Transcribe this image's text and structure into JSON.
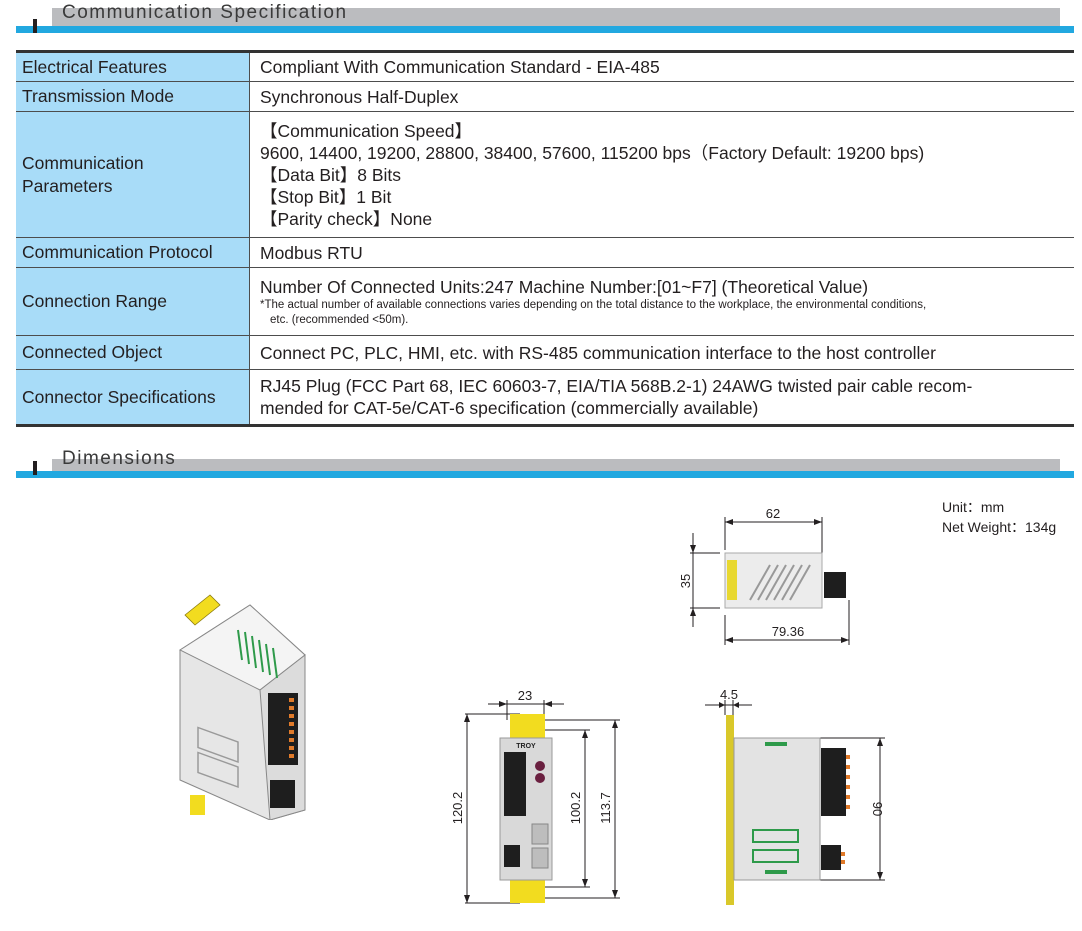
{
  "sections": {
    "communication": {
      "title": "Communication Specification"
    },
    "dimensions": {
      "title": "Dimensions"
    }
  },
  "spec_table": {
    "rows": [
      {
        "label": "Electrical Features",
        "value": "Compliant With Communication Standard - EIA-485"
      },
      {
        "label": "Transmission Mode",
        "value": "Synchronous Half-Duplex"
      },
      {
        "label_lines": [
          "Communication",
          "Parameters"
        ],
        "lines": [
          "【Communication Speed】",
          "9600, 14400, 19200, 28800, 38400, 57600, 115200 bps（Factory Default: 19200 bps)",
          "【Data Bit】8 Bits",
          "【Stop Bit】1 Bit",
          "【Parity check】None"
        ]
      },
      {
        "label": "Communication Protocol",
        "value": "Modbus RTU"
      },
      {
        "label": "Connection Range",
        "value": "Number Of Connected Units:247 Machine Number:[01~F7] (Theoretical Value)",
        "note_line1": "*The actual number of available connections varies depending on the total distance to the workplace, the environmental conditions,",
        "note_line2": "etc. (recommended <50m)."
      },
      {
        "label": "Connected Object",
        "value": "Connect PC, PLC, HMI, etc. with RS-485 communication interface to the host controller"
      },
      {
        "label": "Connector Specifications",
        "lines": [
          "RJ45 Plug (FCC Part 68, IEC 60603-7, EIA/TIA 568B.2-1) 24AWG twisted pair cable recom-",
          "mended for CAT-5e/CAT-6 specification (commercially available)"
        ]
      }
    ]
  },
  "dimensions": {
    "unit_label": "Unit：mm",
    "weight_label": "Net Weight：134g",
    "top_view": {
      "depth_body": "62",
      "depth_total": "79.36",
      "width": "35"
    },
    "front_view": {
      "width": "23",
      "height_total": "120.2",
      "height_mount": "113.7",
      "height_body": "100.2"
    },
    "side_view": {
      "rail_thickness": "4.5",
      "height": "90"
    },
    "brand_mark": "TROY"
  },
  "colors": {
    "header_blue": "#22a8e0",
    "header_gray": "#bbbcbf",
    "label_cell_bg": "#a8dcf8",
    "din_clip_yellow": "#f2dc1f",
    "terminal_orange": "#e07a2a",
    "led_green": "#2e9a4a"
  }
}
